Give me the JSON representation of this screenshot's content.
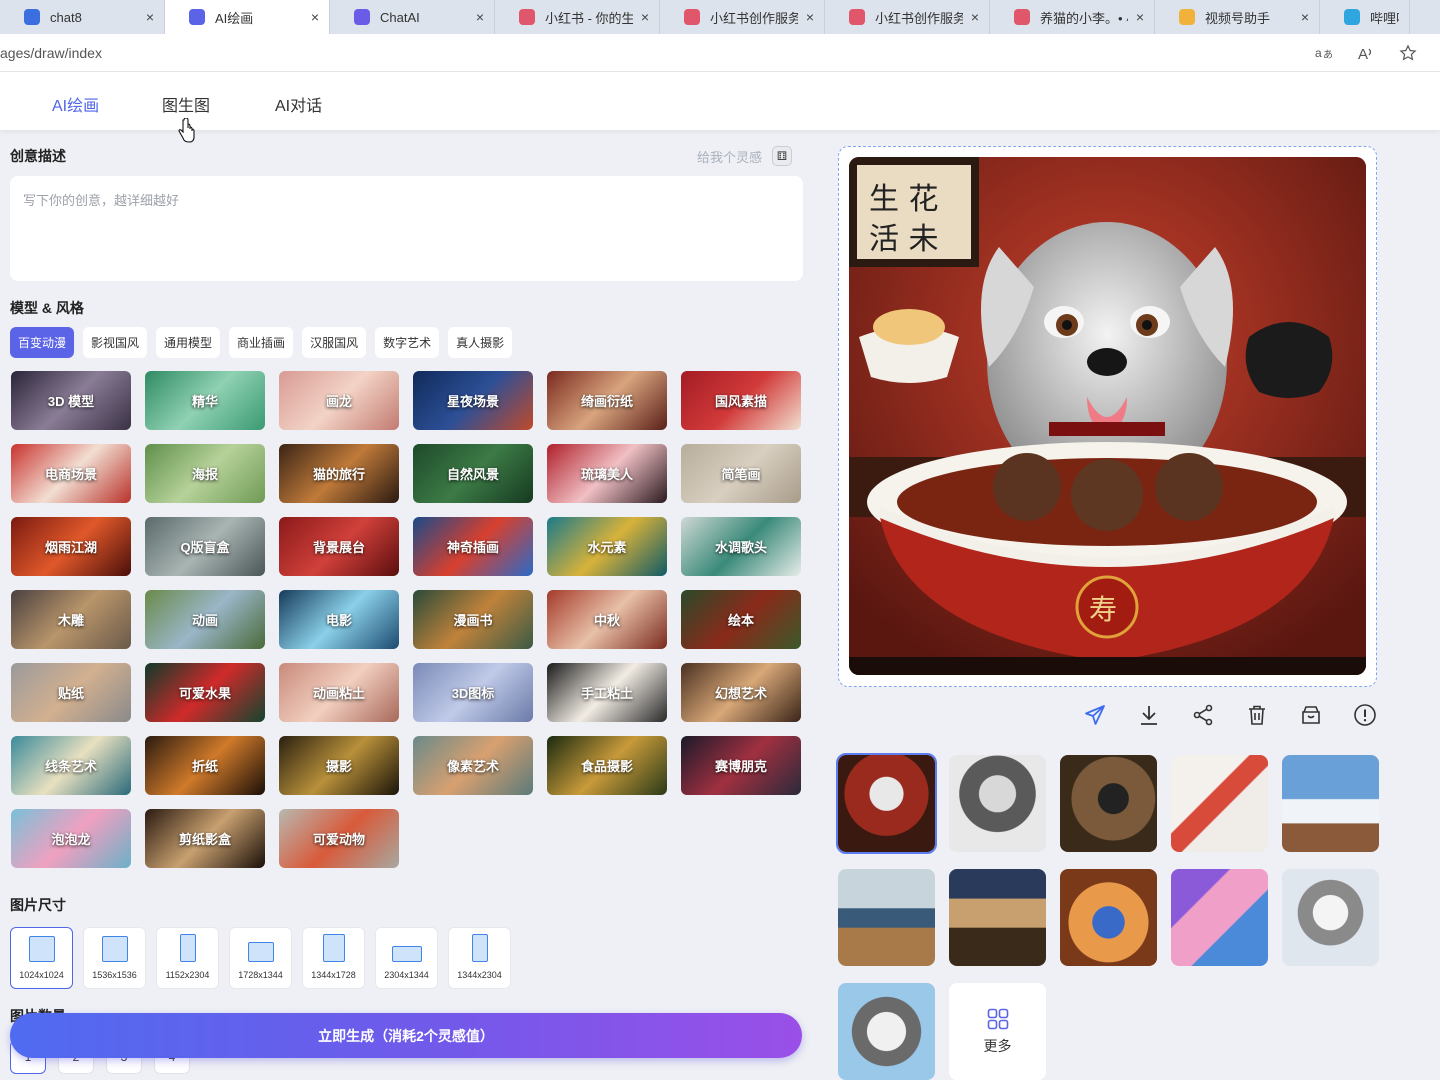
{
  "browser": {
    "tabs": [
      {
        "title": "chat8",
        "icon": "chat-app-icon",
        "color": "#3b6fe0",
        "active": false
      },
      {
        "title": "AI绘画",
        "icon": "ai-draw-icon",
        "color": "#5b63e6",
        "active": true
      },
      {
        "title": "ChatAI",
        "icon": "chatai-icon",
        "color": "#6b5ce7",
        "active": false
      },
      {
        "title": "小红书 - 你的生活",
        "icon": "xiaohongshu-icon",
        "color": "#e0566a",
        "active": false
      },
      {
        "title": "小红书创作服务平台",
        "icon": "xiaohongshu-icon",
        "color": "#e0566a",
        "active": false
      },
      {
        "title": "小红书创作服务平台",
        "icon": "xiaohongshu-icon",
        "color": "#e0566a",
        "active": false
      },
      {
        "title": "养猫的小李。• 小红书",
        "icon": "xiaohongshu-icon",
        "color": "#e0566a",
        "active": false
      },
      {
        "title": "视频号助手",
        "icon": "channels-icon",
        "color": "#f0b23a",
        "active": false
      },
      {
        "title": "哔哩哔哩 (",
        "icon": "bilibili-icon",
        "color": "#2fa6e0",
        "active": false
      }
    ],
    "close_glyph": "×",
    "url": "ages/draw/index"
  },
  "nav": {
    "tabs": [
      "AI绘画",
      "图生图",
      "AI对话"
    ]
  },
  "prompt": {
    "title": "创意描述",
    "inspire": "给我个灵感",
    "placeholder": "写下你的创意，越详细越好"
  },
  "style": {
    "title": "模型 & 风格",
    "tabs": [
      "百变动漫",
      "影视国风",
      "通用模型",
      "商业插画",
      "汉服国风",
      "数字艺术",
      "真人摄影"
    ],
    "cards": [
      "3D 模型",
      "精华",
      "画龙",
      "星夜场景",
      "绮画衍纸",
      "国风素描",
      "电商场景",
      "海报",
      "猫的旅行",
      "自然风景",
      "琉璃美人",
      "简笔画",
      "烟雨江湖",
      "Q版盲盒",
      "背景展台",
      "神奇插画",
      "水元素",
      "水调歌头",
      "木雕",
      "动画",
      "电影",
      "漫画书",
      "中秋",
      "绘本",
      "贴纸",
      "可爱水果",
      "动画粘土",
      "3D图标",
      "手工粘土",
      "幻想艺术",
      "线条艺术",
      "折纸",
      "摄影",
      "像素艺术",
      "食品摄影",
      "赛博朋克",
      "泡泡龙",
      "剪纸影盒",
      "可爱动物"
    ]
  },
  "size": {
    "title": "图片尺寸",
    "options": [
      "1024x1024",
      "1536x1536",
      "1152x2304",
      "1728x1344",
      "1344x1728",
      "2304x1344",
      "1344x2304"
    ]
  },
  "count": {
    "title": "图片数量",
    "options": [
      "1",
      "2",
      "3",
      "4"
    ]
  },
  "generate_button": "立即生成（消耗2个灵感值）",
  "actions": [
    "send-icon",
    "download-icon",
    "share-icon",
    "trash-icon",
    "archive-icon",
    "report-icon"
  ],
  "gallery": {
    "more_label": "更多"
  },
  "colors": {
    "accent": "#4f66e8",
    "generate_start": "#4f6bf0",
    "generate_end": "#9a4fe8"
  }
}
